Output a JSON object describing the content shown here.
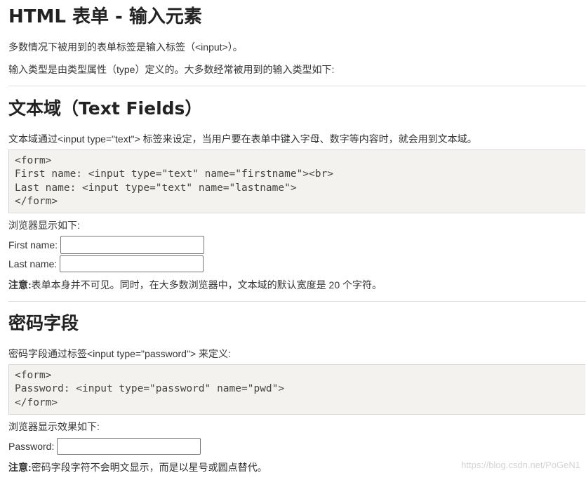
{
  "title": "HTML 表单 - 输入元素",
  "intro": {
    "line1": "多数情况下被用到的表单标签是输入标签（<input>）。",
    "line2": "输入类型是由类型属性（type）定义的。大多数经常被用到的输入类型如下:"
  },
  "text_fields": {
    "heading": "文本域（Text Fields）",
    "description": "文本域通过<input type=\"text\"> 标签来设定，当用户要在表单中键入字母、数字等内容时，就会用到文本域。",
    "code": "<form>\nFirst name: <input type=\"text\" name=\"firstname\"><br>\nLast name: <input type=\"text\" name=\"lastname\">\n</form>",
    "display_label": "浏览器显示如下:",
    "first_name_label": "First name:",
    "first_name_value": "",
    "last_name_label": "Last name:",
    "last_name_value": "",
    "note_bold": "注意:",
    "note_text": "表单本身并不可见。同时，在大多数浏览器中，文本域的默认宽度是 20 个字符。"
  },
  "password": {
    "heading": "密码字段",
    "description": "密码字段通过标签<input type=\"password\"> 来定义:",
    "code": "<form>\nPassword: <input type=\"password\" name=\"pwd\">\n</form>",
    "display_label": "浏览器显示效果如下:",
    "password_label": "Password:",
    "password_value": "",
    "note_bold": "注意:",
    "note_text": "密码字段字符不会明文显示，而是以星号或圆点替代。"
  },
  "watermark": "https://blog.csdn.net/PoGeN1"
}
